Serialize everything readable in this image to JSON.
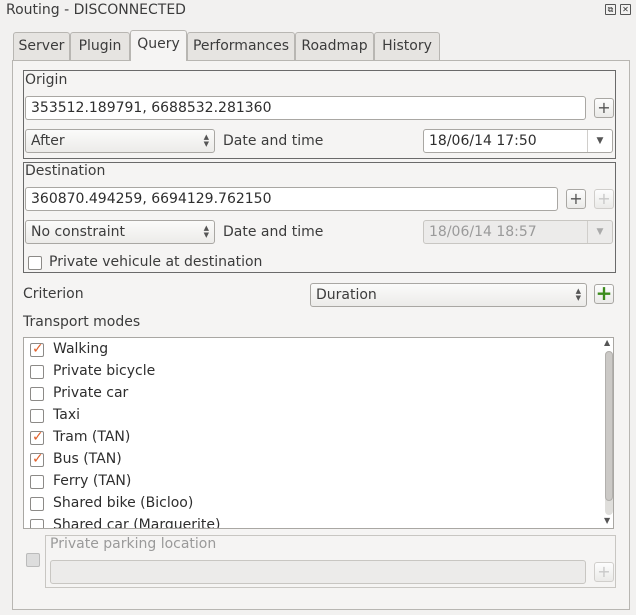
{
  "window": {
    "title": "Routing - DISCONNECTED"
  },
  "tabs": [
    {
      "label": "Server"
    },
    {
      "label": "Plugin"
    },
    {
      "label": "Query"
    },
    {
      "label": "Performances"
    },
    {
      "label": "Roadmap"
    },
    {
      "label": "History"
    }
  ],
  "origin": {
    "title": "Origin",
    "coordinates": "353512.189791, 6688532.281360",
    "constraint": "After",
    "datetime_label": "Date and time",
    "datetime": "18/06/14 17:50"
  },
  "destination": {
    "title": "Destination",
    "coordinates": "360870.494259, 6694129.762150",
    "constraint": "No constraint",
    "datetime_label": "Date and time",
    "datetime": "18/06/14 18:57",
    "private_vehicle_label": "Private vehicule at destination",
    "private_vehicle_checked": false
  },
  "criterion": {
    "label": "Criterion",
    "value": "Duration"
  },
  "transport": {
    "label": "Transport modes",
    "modes": [
      {
        "label": "Walking",
        "checked": true
      },
      {
        "label": "Private bicycle",
        "checked": false
      },
      {
        "label": "Private car",
        "checked": false
      },
      {
        "label": "Taxi",
        "checked": false
      },
      {
        "label": "Tram (TAN)",
        "checked": true
      },
      {
        "label": "Bus (TAN)",
        "checked": true
      },
      {
        "label": "Ferry (TAN)",
        "checked": false
      },
      {
        "label": "Shared bike (Bicloo)",
        "checked": false
      },
      {
        "label": "Shared car (Marguerite)",
        "checked": false
      }
    ]
  },
  "parking": {
    "label": "Private parking location",
    "value": ""
  },
  "icons": {
    "plus": "+",
    "green_plus": "+",
    "restore": "⧉",
    "close": "✕"
  },
  "colors": {
    "check": "#e0602a",
    "green_plus": "#3c8c1c"
  }
}
